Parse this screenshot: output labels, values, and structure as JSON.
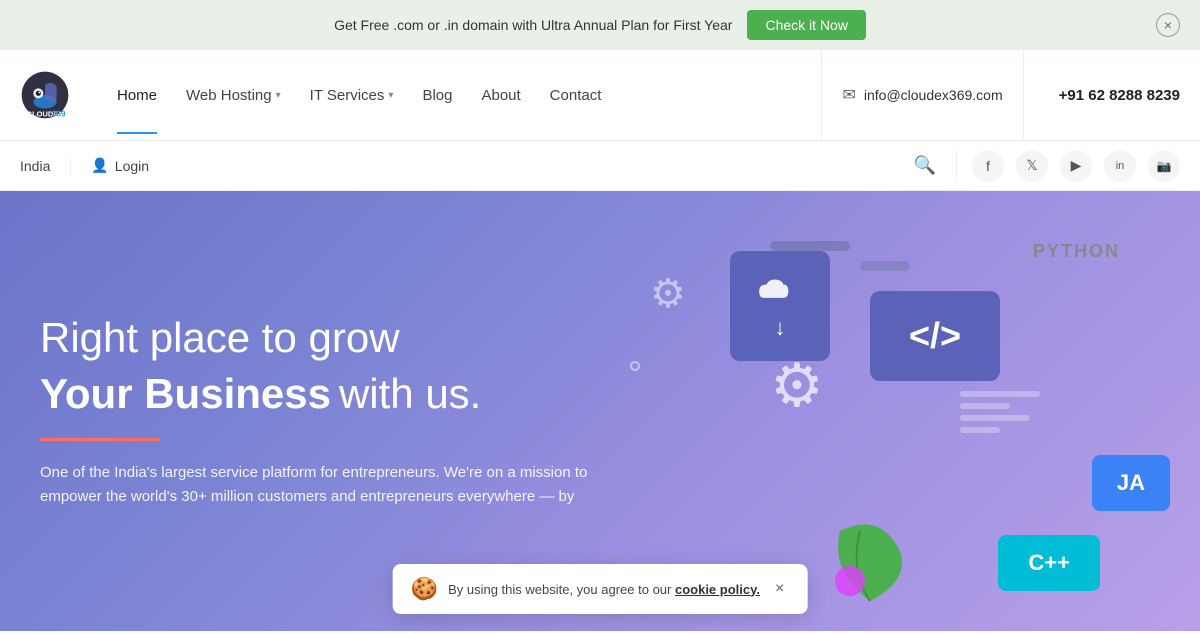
{
  "topBanner": {
    "text": "Get Free .com or .in domain with Ultra Annual Plan for First Year",
    "buttonLabel": "Check it Now"
  },
  "header": {
    "logo": {
      "text": "CLOUDEX",
      "number": "369"
    },
    "nav": [
      {
        "label": "Home",
        "active": true,
        "hasDropdown": false
      },
      {
        "label": "Web Hosting",
        "active": false,
        "hasDropdown": true
      },
      {
        "label": "IT Services",
        "active": false,
        "hasDropdown": true
      },
      {
        "label": "Blog",
        "active": false,
        "hasDropdown": false
      },
      {
        "label": "About",
        "active": false,
        "hasDropdown": false
      },
      {
        "label": "Contact",
        "active": false,
        "hasDropdown": false
      }
    ],
    "email": "info@cloudex369.com",
    "phone": "+91 62 8288 8239"
  },
  "subHeader": {
    "country": "India",
    "loginLabel": "Login"
  },
  "hero": {
    "line1": "Right place to grow",
    "boldWord": "Your Business",
    "suffix": " with us.",
    "description": "One of the India's largest service platform for entrepreneurs. We're on a mission to empower the world's 30+ million customers and entrepreneurs everywhere — by"
  },
  "techLabels": {
    "python": "PYTHON",
    "java": "JA",
    "cpp": "C++"
  },
  "cookie": {
    "text": "By using this website, you agree to our ",
    "linkText": "cookie policy.",
    "icon": "🍪"
  },
  "icons": {
    "search": "🔍",
    "user": "👤",
    "email": "✉",
    "facebook": "f",
    "twitter": "t",
    "youtube": "▶",
    "linkedin": "in",
    "instagram": "📷",
    "close": "×",
    "chevron": "▾",
    "gear": "⚙",
    "download": "↓",
    "code": "</>"
  }
}
